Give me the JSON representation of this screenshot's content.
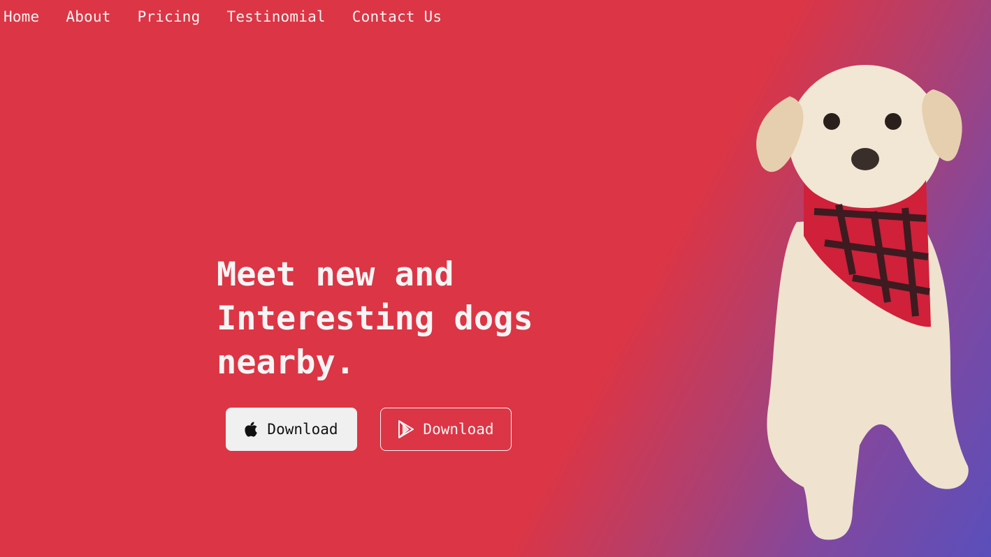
{
  "nav": {
    "items": [
      {
        "label": "Home"
      },
      {
        "label": "About"
      },
      {
        "label": "Pricing"
      },
      {
        "label": "Testinomial"
      },
      {
        "label": "Contact Us"
      }
    ]
  },
  "hero": {
    "title_line1": "Meet new and",
    "title_line2": "Interesting dogs",
    "title_line3": "nearby."
  },
  "buttons": {
    "apple_download": {
      "label": "Download",
      "icon": "apple-icon"
    },
    "play_download": {
      "label": "Download",
      "icon": "google-play-icon"
    }
  },
  "colors": {
    "background_primary": "#dc3545",
    "background_gradient_end": "#5a4fbb",
    "text": "#f5f5f5"
  },
  "image": {
    "subject": "dog-with-red-plaid-bandana"
  }
}
